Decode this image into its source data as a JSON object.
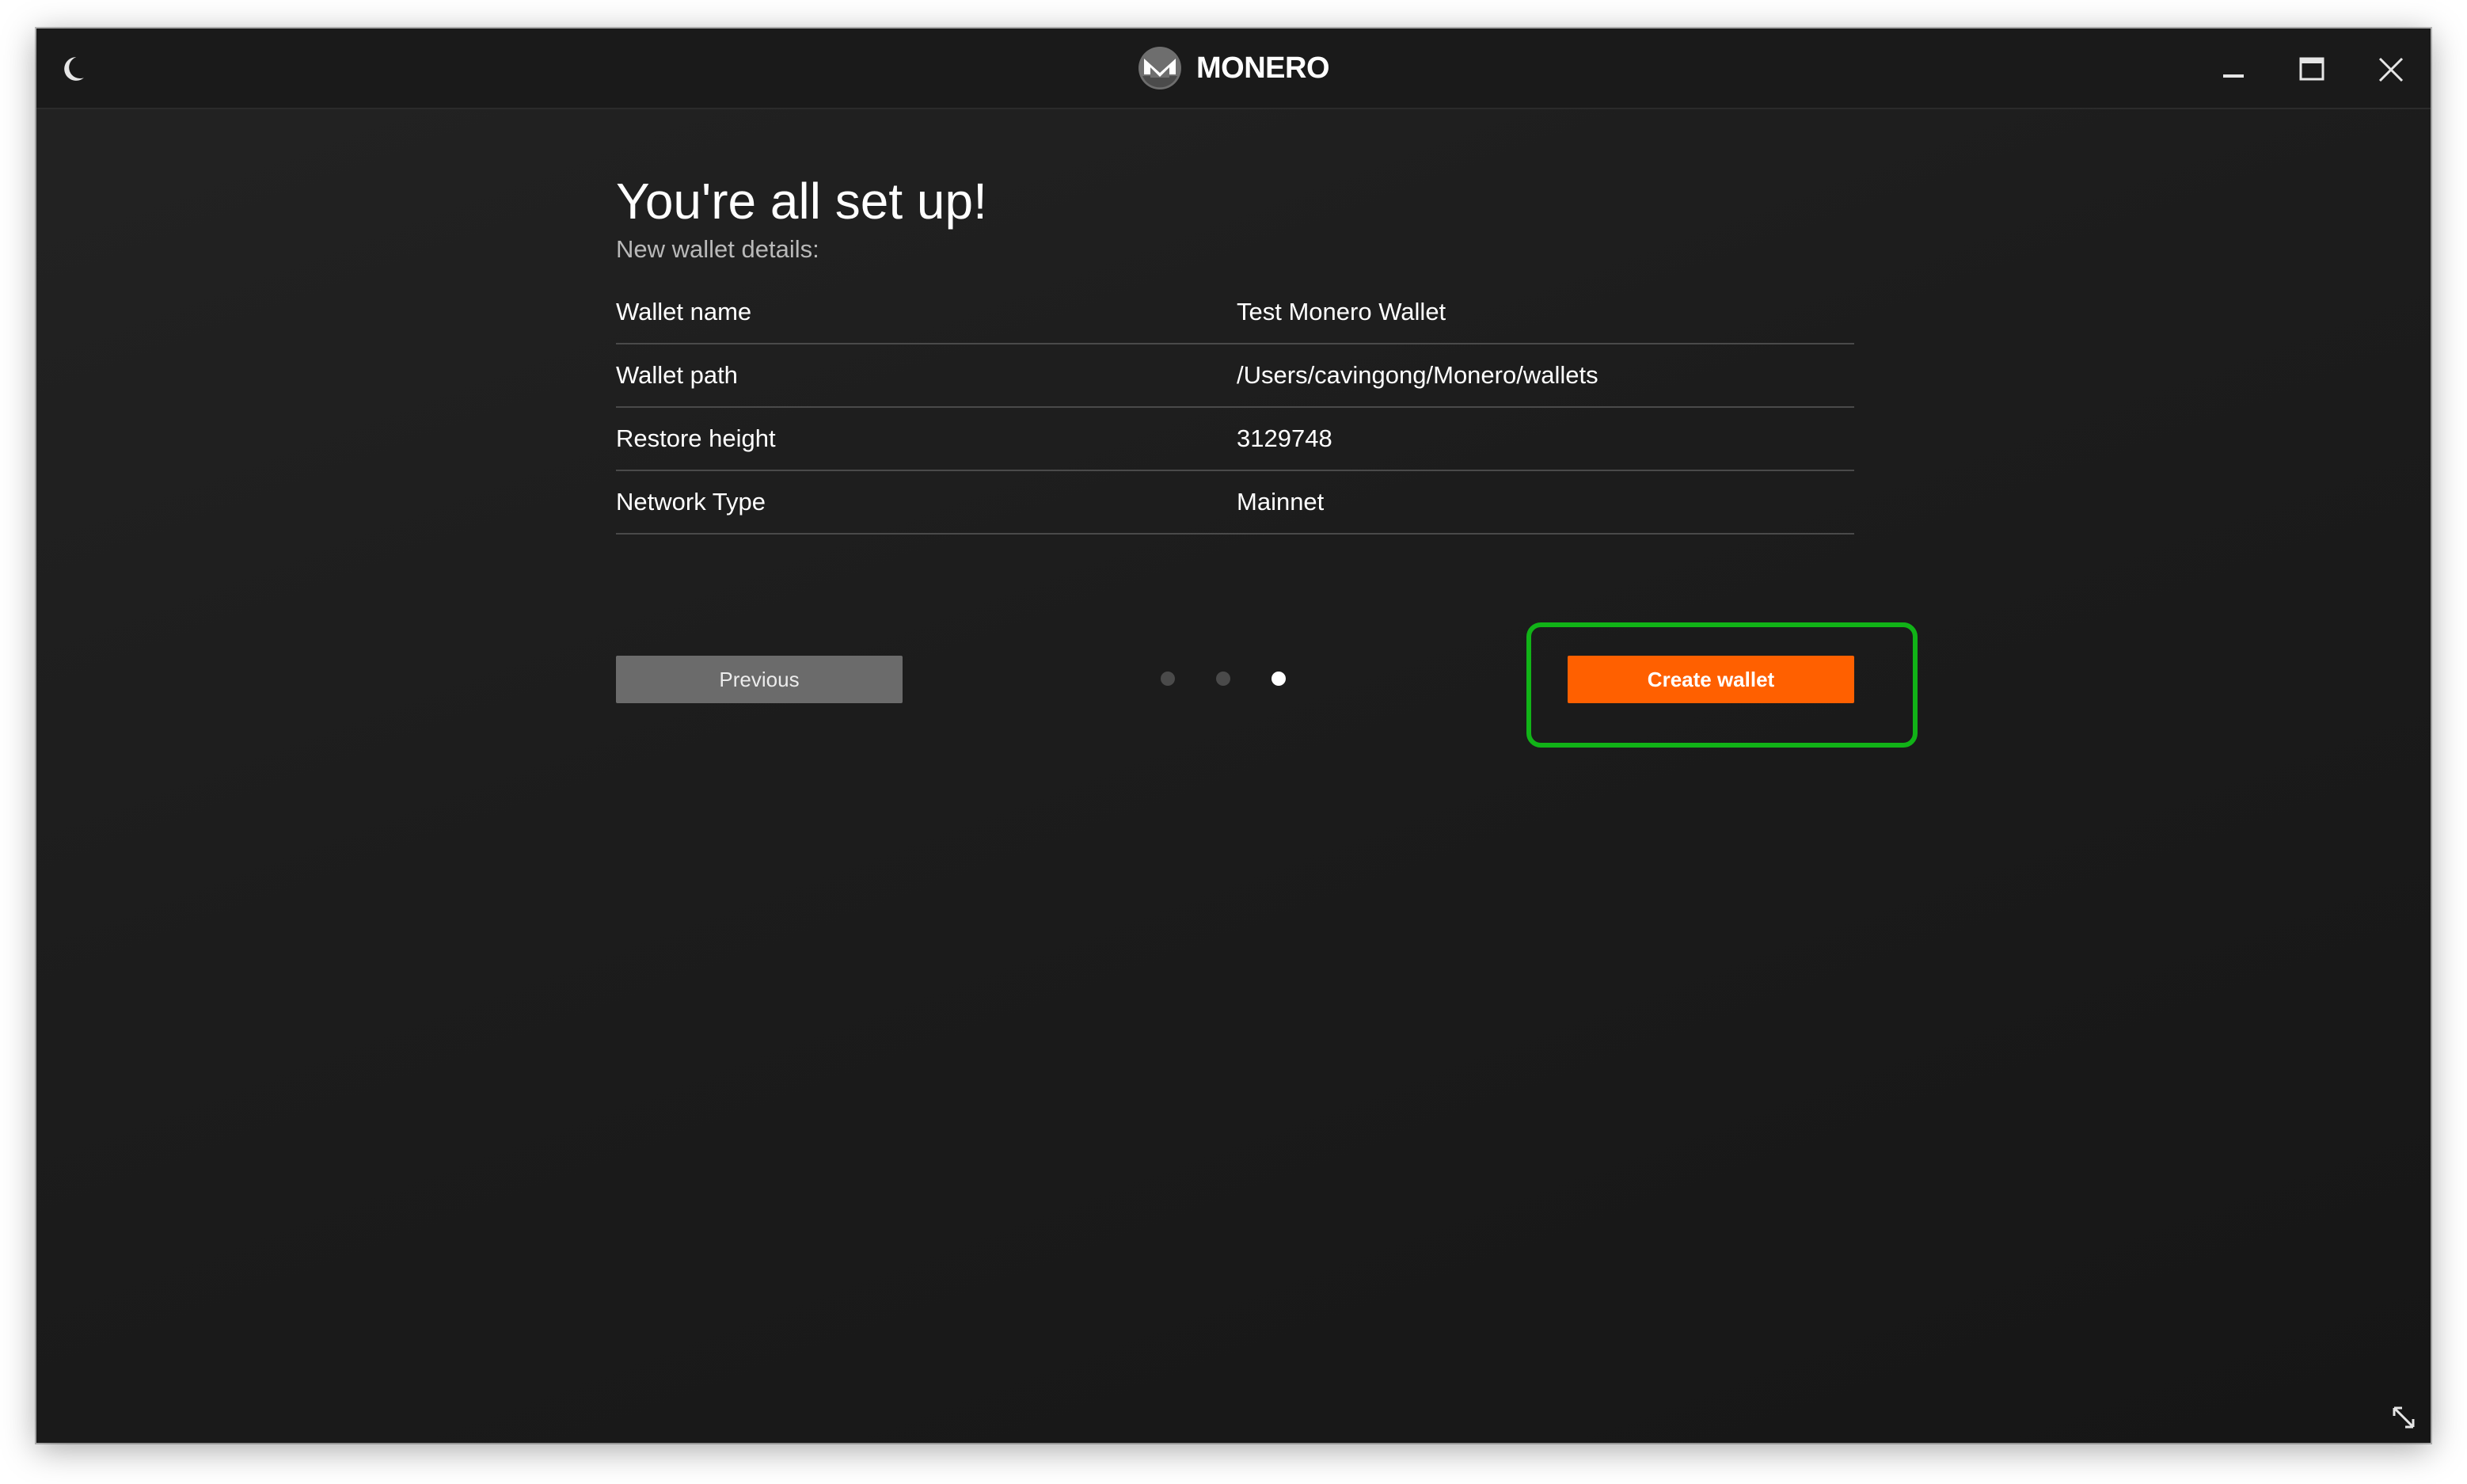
{
  "app": {
    "brand_name": "MONERO",
    "theme_icon": "moon-icon",
    "window_controls": [
      "minimize-icon",
      "maximize-icon",
      "close-icon"
    ]
  },
  "page": {
    "title": "You're all set up!",
    "subtitle": "New wallet details:"
  },
  "details": [
    {
      "label": "Wallet name",
      "value": "Test Monero Wallet"
    },
    {
      "label": "Wallet path",
      "value": "/Users/cavingong/Monero/wallets"
    },
    {
      "label": "Restore height",
      "value": "3129748"
    },
    {
      "label": "Network Type",
      "value": "Mainnet"
    }
  ],
  "navigation": {
    "previous_label": "Previous",
    "create_label": "Create wallet",
    "steps_total": 3,
    "current_step": 3
  },
  "colors": {
    "accent": "#ff6000",
    "highlight": "#11b317",
    "background": "#1c1c1c"
  }
}
